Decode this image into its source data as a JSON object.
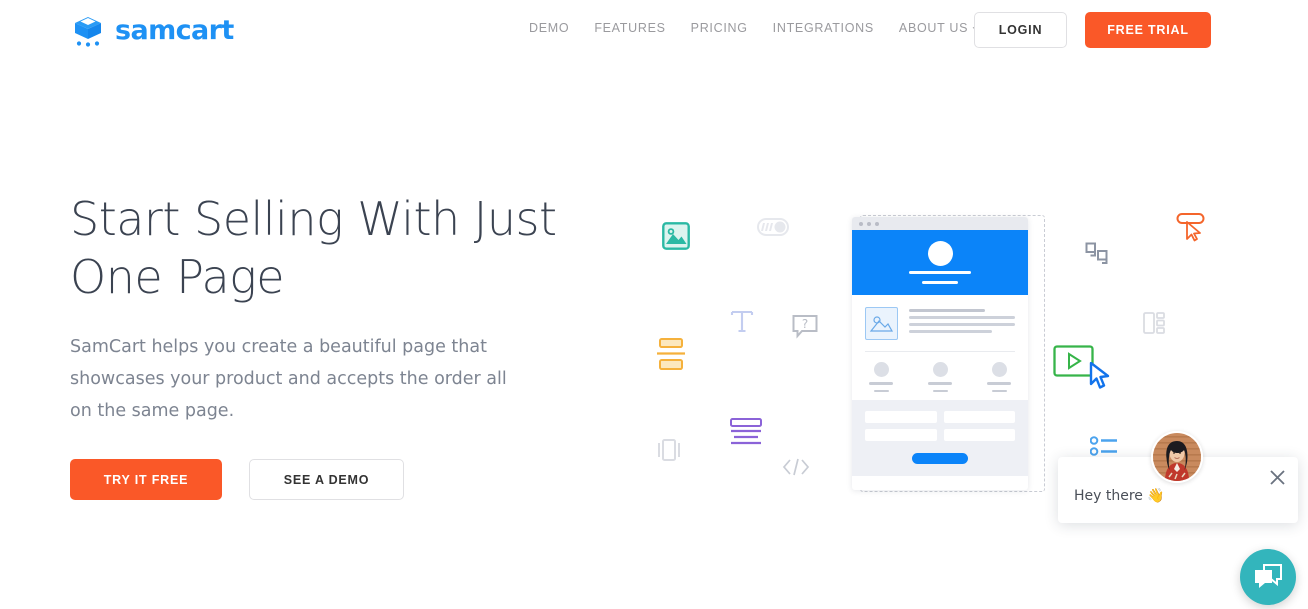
{
  "header": {
    "logo": {
      "text": "samcart",
      "icon": "shopping-cart-icon",
      "color": "#1E91F4"
    },
    "nav": [
      {
        "label": "DEMO"
      },
      {
        "label": "FEATURES"
      },
      {
        "label": "PRICING"
      },
      {
        "label": "INTEGRATIONS"
      },
      {
        "label": "ABOUT US",
        "has_dropdown": true,
        "chevron": "ˇ"
      }
    ],
    "login_label": "LOGIN",
    "free_trial_label": "FREE TRIAL"
  },
  "hero": {
    "title": "Start Selling With Just One Page",
    "subtitle": "SamCart helps you create a beautiful page that showcases your product and accepts the order all on the same page.",
    "primary_cta": "TRY IT FREE",
    "secondary_cta": "SEE A DEMO"
  },
  "illustration": {
    "mockup_name": "one-page-checkout-mockup",
    "floating_icons": [
      {
        "name": "image-block-icon",
        "color": "#2BB9A4"
      },
      {
        "name": "toggle-switch-icon",
        "color": "#e4e6eb"
      },
      {
        "name": "text-block-icon",
        "color": "#c3cdf0"
      },
      {
        "name": "faq-bubble-icon",
        "color": "#b9bdc6"
      },
      {
        "name": "divider-block-icon",
        "color": "#F5B13C"
      },
      {
        "name": "text-align-icon",
        "color": "#8B63D8"
      },
      {
        "name": "carousel-icon",
        "color": "#dadce2"
      },
      {
        "name": "code-block-icon",
        "color": "#c8ccd4"
      },
      {
        "name": "button-cursor-icon",
        "color": "#F4652B"
      },
      {
        "name": "quote-block-icon",
        "color": "#8c94a3"
      },
      {
        "name": "two-column-layout-icon",
        "color": "#dadce2"
      },
      {
        "name": "video-play-icon",
        "color": "#36B449"
      },
      {
        "name": "mouse-cursor-icon",
        "color": "#1273EB"
      },
      {
        "name": "bullet-list-icon",
        "color": "#4BA3EE"
      }
    ],
    "colors": {
      "mock_blue": "#0B84F9",
      "form_bg": "#EEF0F5"
    }
  },
  "chat": {
    "message": "Hey there 👋",
    "close_label": "close-chat",
    "fab_color": "#33B5BC",
    "avatar_alt": "support-agent-avatar"
  }
}
